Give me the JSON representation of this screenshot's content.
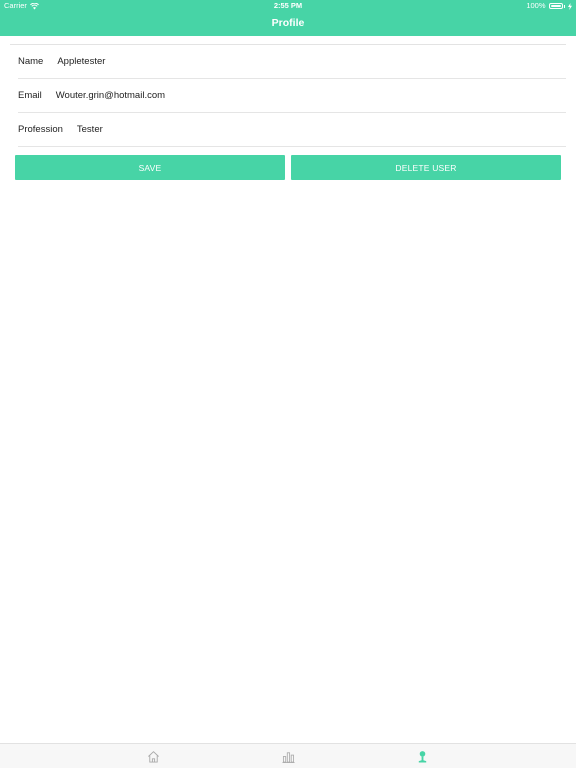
{
  "status_bar": {
    "carrier": "Carrier",
    "time": "2:55 PM",
    "battery": "100%"
  },
  "header": {
    "title": "Profile"
  },
  "profile": {
    "name_label": "Name",
    "name_value": "Appletester",
    "email_label": "Email",
    "email_value": "Wouter.grin@hotmail.com",
    "profession_label": "Profession",
    "profession_value": "Tester"
  },
  "actions": {
    "save_label": "SAVE",
    "delete_label": "DELETE USER"
  },
  "tabbar": {
    "tabs": [
      {
        "icon": "home-icon",
        "active": false
      },
      {
        "icon": "bar-chart-icon",
        "active": false
      },
      {
        "icon": "user-icon",
        "active": true
      }
    ]
  },
  "colors": {
    "accent": "#47d4a6",
    "inactive_tab": "#a9a9a9"
  }
}
